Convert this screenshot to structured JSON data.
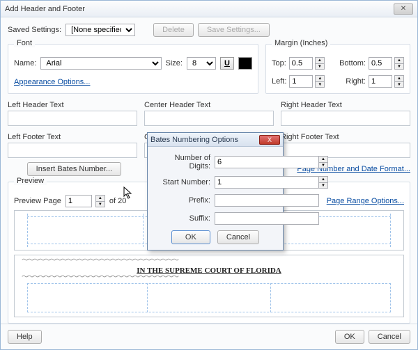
{
  "window": {
    "title": "Add Header and Footer"
  },
  "saved": {
    "label": "Saved Settings:",
    "value": "[None specified]",
    "delete": "Delete",
    "save": "Save Settings..."
  },
  "font": {
    "legend": "Font",
    "name_label": "Name:",
    "name_value": "Arial",
    "size_label": "Size:",
    "size_value": "8",
    "appearance_link": "Appearance Options..."
  },
  "margin": {
    "legend": "Margin (Inches)",
    "top_label": "Top:",
    "top_value": "0.5",
    "bottom_label": "Bottom:",
    "bottom_value": "0.5",
    "left_label": "Left:",
    "left_value": "1",
    "right_label": "Right:",
    "right_value": "1"
  },
  "headers": {
    "left_h": "Left Header Text",
    "center_h": "Center Header Text",
    "right_h": "Right Header Text",
    "left_f": "Left Footer Text",
    "center_f": "Center Footer Text",
    "right_f": "Right Footer Text"
  },
  "insert": {
    "bates": "Insert Bates Number...",
    "page_date_link": "Page Number and Date Format..."
  },
  "preview": {
    "legend": "Preview",
    "page_label": "Preview Page",
    "page_value": "1",
    "of_text": "of 20",
    "range_link": "Page Range Options...",
    "doc_line": "IN THE SUPREME COURT OF FLORIDA"
  },
  "footer": {
    "help": "Help",
    "ok": "OK",
    "cancel": "Cancel"
  },
  "modal": {
    "title": "Bates Numbering Options",
    "digits_label": "Number of Digits:",
    "digits_value": "6",
    "start_label": "Start Number:",
    "start_value": "1",
    "prefix_label": "Prefix:",
    "prefix_value": "",
    "suffix_label": "Suffix:",
    "suffix_value": "",
    "ok": "OK",
    "cancel": "Cancel"
  }
}
